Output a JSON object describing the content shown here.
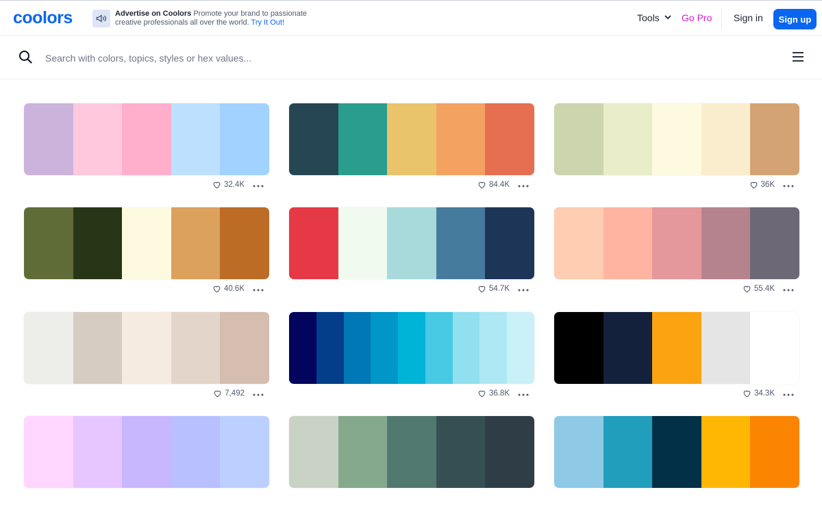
{
  "header": {
    "logo": "coolors",
    "ad": {
      "title": "Advertise on Coolors",
      "text": "Promote your brand to passionate creative professionals all over the world.",
      "link": "Try It Out!"
    },
    "nav": {
      "tools": "Tools",
      "go_pro": "Go Pro",
      "sign_in": "Sign in",
      "sign_up": "Sign up"
    }
  },
  "search": {
    "placeholder": "Search with colors, topics, styles or hex values..."
  },
  "palettes": [
    {
      "colors": [
        "#cbb3dc",
        "#ffc8dd",
        "#ffafcc",
        "#bde0fe",
        "#a2d2ff"
      ],
      "likes": "32.4K"
    },
    {
      "colors": [
        "#264653",
        "#2a9d8f",
        "#e9c46a",
        "#f4a261",
        "#e76f51"
      ],
      "likes": "84.4K"
    },
    {
      "colors": [
        "#ccd5ae",
        "#e9edc9",
        "#fefae0",
        "#faedcd",
        "#d4a373"
      ],
      "likes": "36K"
    },
    {
      "colors": [
        "#606c38",
        "#283618",
        "#fefae0",
        "#dda15e",
        "#bc6c25"
      ],
      "likes": "40.6K"
    },
    {
      "colors": [
        "#e63946",
        "#f1faee",
        "#a8dadc",
        "#457b9d",
        "#1d3557"
      ],
      "likes": "54.7K"
    },
    {
      "colors": [
        "#ffcdb2",
        "#ffb4a2",
        "#e5989b",
        "#b5838d",
        "#6d6875"
      ],
      "likes": "55.4K"
    },
    {
      "colors": [
        "#edede9",
        "#d6ccc2",
        "#f5ebe0",
        "#e3d5ca",
        "#d5bdaf"
      ],
      "likes": "7,492"
    },
    {
      "colors": [
        "#03045e",
        "#023e8a",
        "#0077b6",
        "#0096c7",
        "#00b4d8",
        "#48cae4",
        "#90e0ef",
        "#ade8f4",
        "#caf0f8"
      ],
      "likes": "36.8K"
    },
    {
      "colors": [
        "#000000",
        "#14213d",
        "#fca311",
        "#e5e5e5",
        "#ffffff"
      ],
      "likes": "34.3K"
    },
    {
      "colors": [
        "#ffd6ff",
        "#e7c6ff",
        "#c8b6ff",
        "#b8c0ff",
        "#bbd0ff"
      ],
      "likes": ""
    },
    {
      "colors": [
        "#cad2c5",
        "#84a98c",
        "#52796f",
        "#354f52",
        "#2f3e46"
      ],
      "likes": ""
    },
    {
      "colors": [
        "#8ecae6",
        "#219ebc",
        "#023047",
        "#ffb703",
        "#fb8500"
      ],
      "likes": ""
    }
  ]
}
